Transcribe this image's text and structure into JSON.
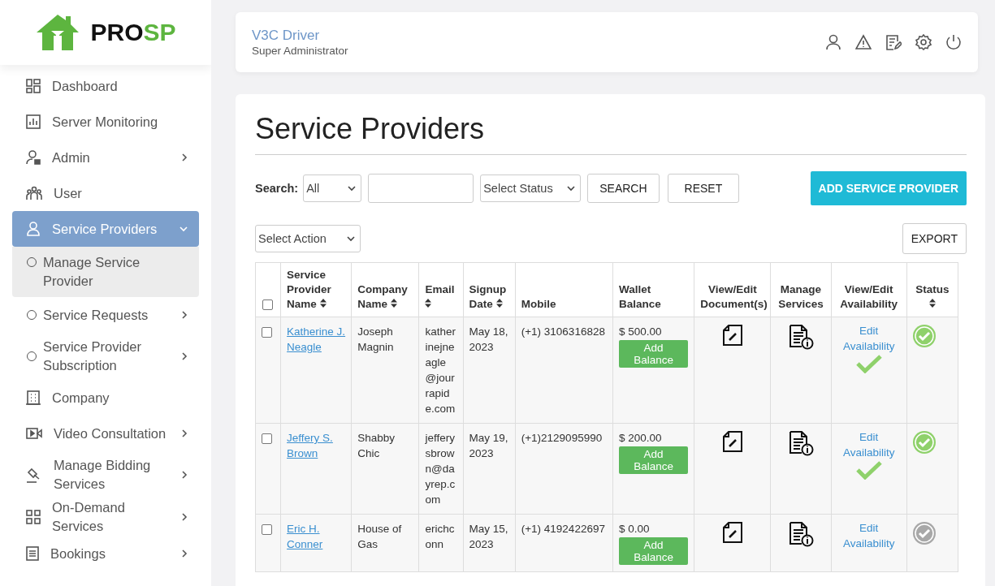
{
  "sidebar": {
    "logo": [
      "PRO",
      "SP"
    ],
    "items": [
      {
        "label": "Dashboard",
        "selected": false,
        "has_submenu": false
      },
      {
        "label": "Server Monitoring",
        "selected": false,
        "has_submenu": false
      },
      {
        "label": "Admin",
        "selected": false,
        "has_submenu": true,
        "expanded": false
      },
      {
        "label": "User",
        "selected": false,
        "has_submenu": false
      },
      {
        "label": "Service Providers",
        "selected": true,
        "has_submenu": true,
        "expanded": true,
        "children": [
          {
            "label": "Manage Service Provider",
            "selected": true,
            "has_submenu": false
          },
          {
            "label": "Service Requests",
            "selected": false,
            "has_submenu": true,
            "expanded": false
          },
          {
            "label": "Service Provider Subscription",
            "selected": false,
            "has_submenu": true,
            "expanded": false
          }
        ]
      },
      {
        "label": "Company",
        "selected": false,
        "has_submenu": false
      },
      {
        "label": "Video Consultation",
        "selected": false,
        "has_submenu": true,
        "expanded": false
      },
      {
        "label": "Manage Bidding Services",
        "selected": false,
        "has_submenu": true,
        "expanded": false
      },
      {
        "label": "On-Demand Services",
        "selected": false,
        "has_submenu": true,
        "expanded": false
      },
      {
        "label": "Bookings",
        "selected": false,
        "has_submenu": true,
        "expanded": false
      }
    ]
  },
  "header": {
    "user_name": "V3C Driver",
    "role": "Super Administrator"
  },
  "panel": {
    "title": "Service Providers",
    "search_label": "Search:",
    "search_scope": "All",
    "status_placeholder": "Select Status",
    "search_button": "SEARCH",
    "reset_button": "RESET",
    "add_button": "ADD SERVICE PROVIDER",
    "action_placeholder": "Select Action",
    "export_button": "EXPORT",
    "table": {
      "select_all": false,
      "columns": [
        {
          "label": "Service Provider Name",
          "sortable": true
        },
        {
          "label": "Company Name",
          "sortable": true
        },
        {
          "label": "Email",
          "sortable": true
        },
        {
          "label": "Signup Date",
          "sortable": true
        },
        {
          "label": "Mobile",
          "sortable": false
        },
        {
          "label": "Wallet Balance",
          "sortable": false
        },
        {
          "label": "View/Edit Document(s)",
          "sortable": false
        },
        {
          "label": "Manage Services",
          "sortable": false
        },
        {
          "label": "View/Edit Availability",
          "sortable": false
        },
        {
          "label": "Status",
          "sortable": true
        }
      ],
      "rows": [
        {
          "checked": false,
          "name": "Katherine J. Neagle",
          "company": "Joseph Magnin",
          "email": "katherinejneagle@jourrapide.com",
          "signup": "May 18, 2023",
          "mobile": "(+1) 3106316828",
          "wallet": "$ 500.00",
          "balance_button": "Add Balance",
          "availability_link": "Edit Availability",
          "available": true,
          "active": true
        },
        {
          "checked": false,
          "name": "Jeffery S. Brown",
          "company": "Shabby Chic",
          "email": "jefferysbrown@dayrep.com",
          "signup": "May 19, 2023",
          "mobile": "(+1)2129095990",
          "wallet": "$ 200.00",
          "balance_button": "Add Balance",
          "availability_link": "Edit Availability",
          "available": true,
          "active": true
        },
        {
          "checked": false,
          "name": "Eric H. Conner",
          "company": "House of Gas",
          "email": "erichconn",
          "signup": "May 15, 2023",
          "mobile": "(+1) 4192422697",
          "wallet": "$ 0.00",
          "balance_button": "Add Balance",
          "availability_link": "Edit Availability",
          "active": false
        }
      ]
    }
  }
}
